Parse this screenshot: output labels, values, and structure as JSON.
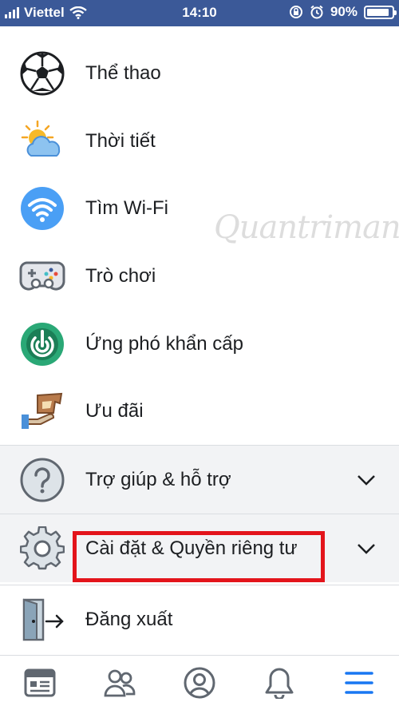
{
  "status": {
    "carrier": "Viettel",
    "time": "14:10",
    "battery": "90%",
    "battery_level": 0.9
  },
  "menu": [
    {
      "label": "Thể thao",
      "icon": "soccer-ball-icon"
    },
    {
      "label": "Thời tiết",
      "icon": "weather-icon"
    },
    {
      "label": "Tìm Wi-Fi",
      "icon": "wifi-icon"
    },
    {
      "label": "Trò chơi",
      "icon": "gamepad-icon"
    },
    {
      "label": "Ứng phó khẩn cấp",
      "icon": "crisis-response-icon"
    },
    {
      "label": "Ưu đãi",
      "icon": "offers-icon"
    }
  ],
  "sections": [
    {
      "label": "Trợ giúp & hỗ trợ",
      "icon": "help-icon"
    },
    {
      "label": "Cài đặt & Quyền riêng tư",
      "icon": "gear-icon"
    }
  ],
  "logout": {
    "label": "Đăng xuất",
    "icon": "logout-door-icon"
  },
  "watermark": "Quantrimang",
  "colors": {
    "status_bar": "#3b5998",
    "highlight": "#e3141b",
    "active_tab": "#1877f2"
  },
  "tabs": [
    {
      "icon": "news-feed-icon"
    },
    {
      "icon": "friends-icon"
    },
    {
      "icon": "profile-icon"
    },
    {
      "icon": "notifications-bell-icon"
    },
    {
      "icon": "menu-hamburger-icon"
    }
  ]
}
